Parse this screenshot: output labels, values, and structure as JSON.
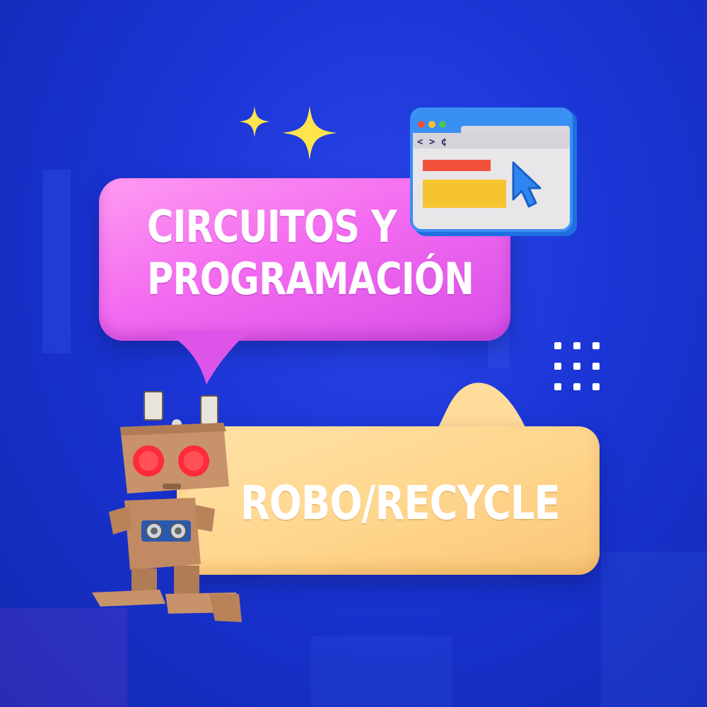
{
  "headline": {
    "line1": "CIRCUITOS Y",
    "line2": "PROGRAMACIÓN"
  },
  "subheadline": "ROBO/RECYCLE",
  "colors": {
    "background": "#1a34d4",
    "pink_bubble": "#f36bf0",
    "yellow_bubble": "#ffd78f",
    "sparkle": "#ffe44d",
    "text": "#ffffff"
  },
  "icons": [
    "sparkle-icon",
    "browser-window-icon",
    "cursor-arrow-icon",
    "dot-grid-icon",
    "robot-image"
  ]
}
